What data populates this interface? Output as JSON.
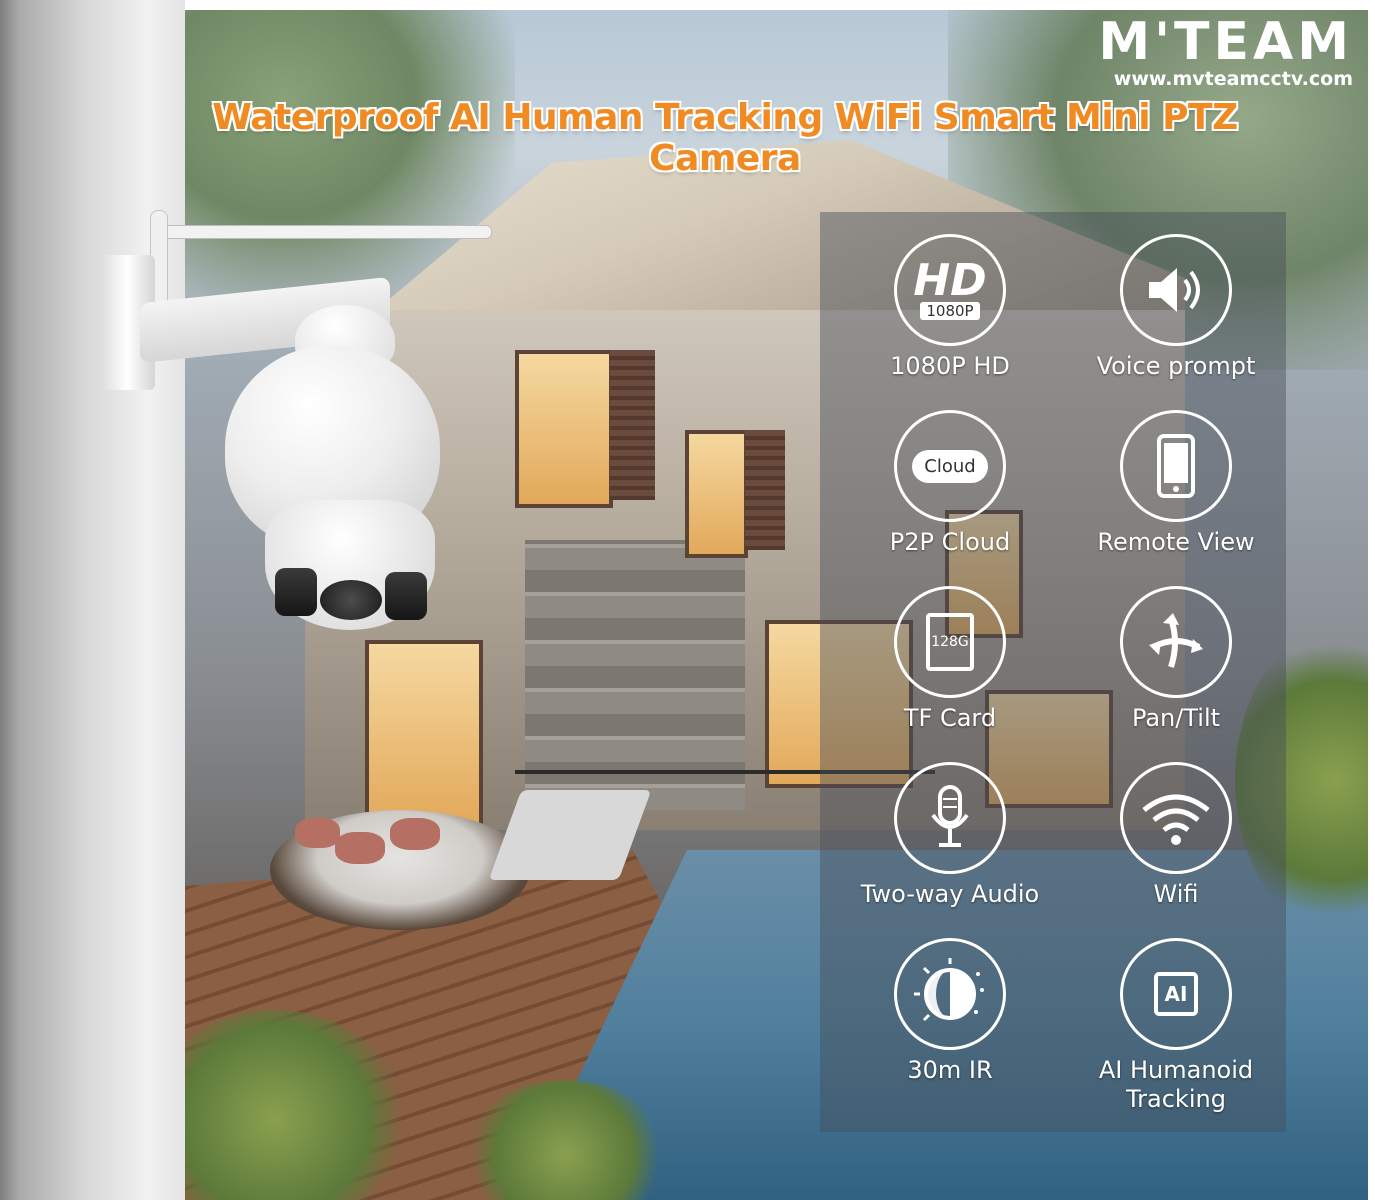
{
  "brand": {
    "name": "M'TEAM",
    "url": "www.mvteamcctv.com"
  },
  "headline": "Waterproof AI Human Tracking WiFi Smart Mini PTZ Camera",
  "icons": {
    "hd_big": "HD",
    "hd_small": "1080P",
    "cloud": "Cloud",
    "tf_card": "128G",
    "ai_chip": "AI"
  },
  "features": [
    {
      "label": "1080P HD",
      "icon": "hd-1080p-icon"
    },
    {
      "label": "Voice prompt",
      "icon": "speaker-icon"
    },
    {
      "label": "P2P Cloud",
      "icon": "cloud-icon"
    },
    {
      "label": "Remote View",
      "icon": "smartphone-icon"
    },
    {
      "label": "TF Card",
      "icon": "sd-card-icon"
    },
    {
      "label": "Pan/Tilt",
      "icon": "pan-tilt-arrows-icon"
    },
    {
      "label": "Two-way Audio",
      "icon": "microphone-icon"
    },
    {
      "label": "Wifi",
      "icon": "wifi-icon"
    },
    {
      "label": "30m IR",
      "icon": "night-vision-icon"
    },
    {
      "label": "AI Humanoid\nTracking",
      "icon": "ai-chip-icon"
    }
  ],
  "colors": {
    "headline": "#f08a22",
    "accent_orange": "#f47c1a",
    "panel": "#464e58"
  }
}
